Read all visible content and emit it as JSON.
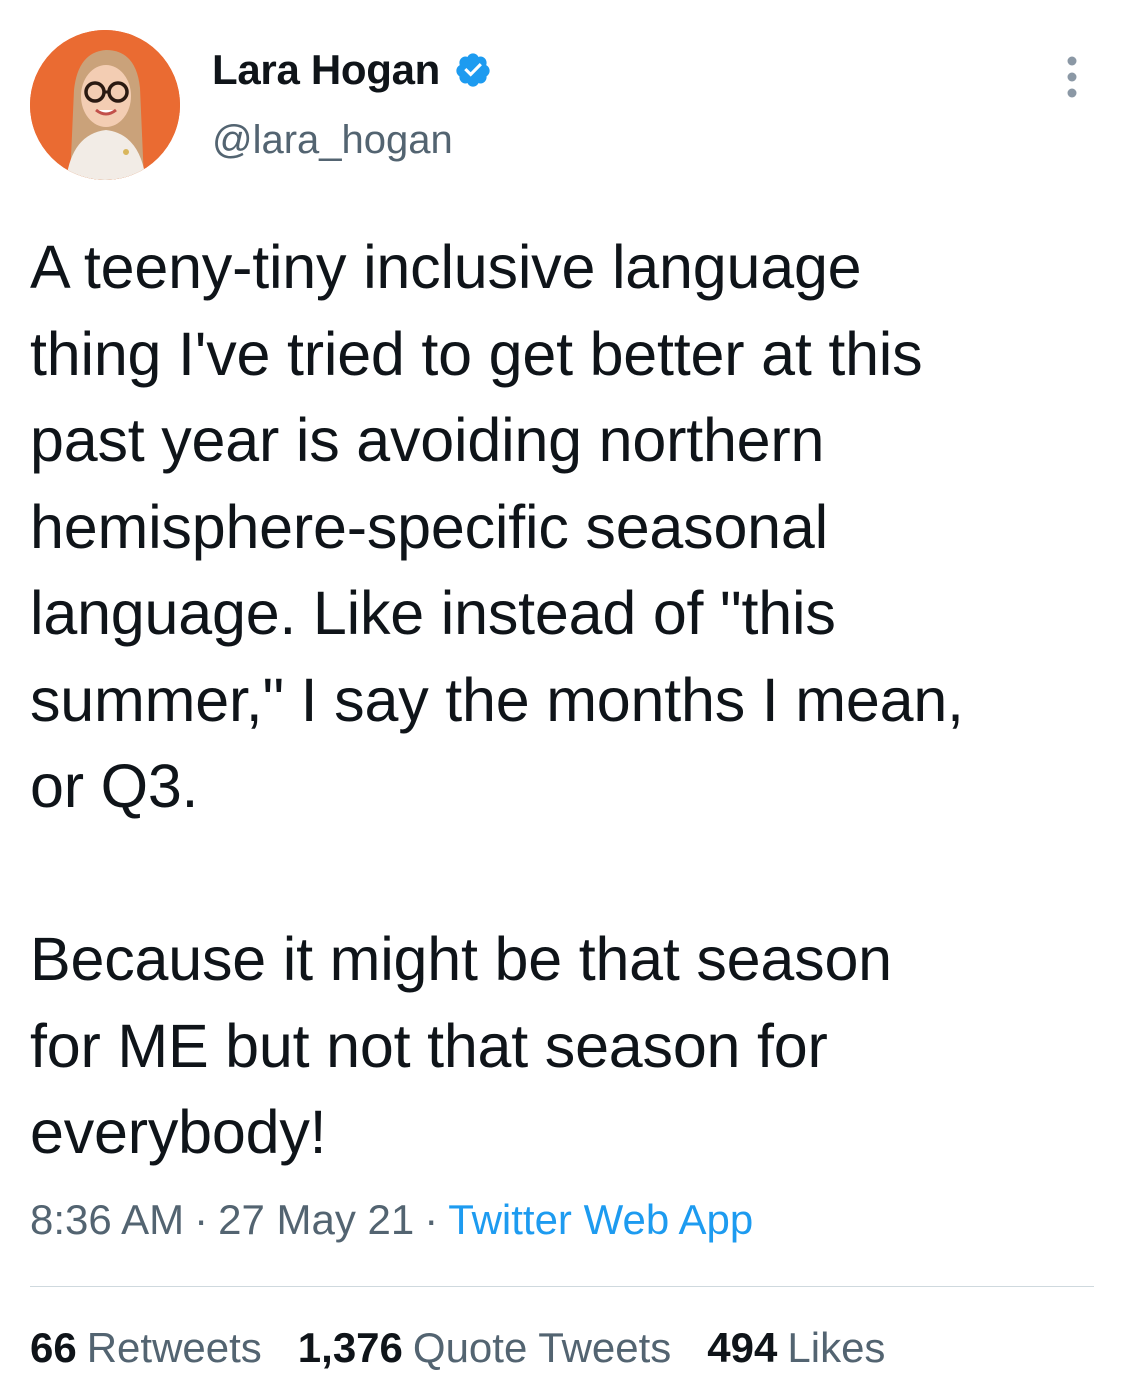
{
  "author": {
    "display_name": "Lara Hogan",
    "handle": "@lara_hogan",
    "verified": true,
    "avatar_icon": "profile-photo",
    "verified_icon": "verified-badge-icon",
    "more_icon": "more-vertical-icon"
  },
  "tweet": {
    "paragraph_1": [
      "A teeny-tiny inclusive language",
      "thing I've tried to get better at this",
      "past year is avoiding northern",
      "hemisphere-specific seasonal",
      "language. Like instead of \"this",
      "summer,\" I say the months I mean,",
      "or Q3."
    ],
    "paragraph_2": [
      "Because it might be that season",
      "for ME but not that season for",
      "everybody!"
    ]
  },
  "meta": {
    "time": "8:36 AM",
    "separator": "·",
    "date": "27 May 21",
    "source": "Twitter Web App"
  },
  "stats": {
    "retweets_count": "66",
    "retweets_label": "Retweets",
    "quotes_count": "1,376",
    "quotes_label": "Quote Tweets",
    "likes_count": "494",
    "likes_label": "Likes"
  },
  "colors": {
    "text": "#0f1419",
    "secondary": "#536471",
    "link": "#1d9bf0",
    "verified": "#1d9bf0",
    "avatar_bg": "#e8632b"
  }
}
